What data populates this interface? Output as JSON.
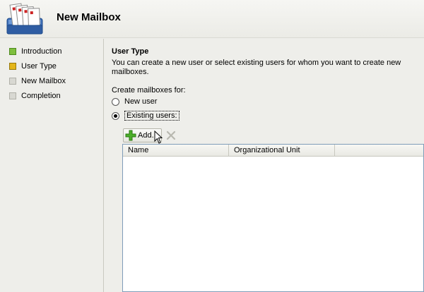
{
  "header": {
    "title": "New Mailbox"
  },
  "nav": {
    "items": [
      {
        "label": "Introduction",
        "state": "done"
      },
      {
        "label": "User Type",
        "state": "current"
      },
      {
        "label": "New Mailbox",
        "state": "pending"
      },
      {
        "label": "Completion",
        "state": "pending"
      }
    ]
  },
  "main": {
    "section_title": "User Type",
    "description": "You can create a new user or select existing users for whom you want to create new mailboxes.",
    "create_label": "Create mailboxes for:",
    "radios": [
      {
        "label": "New user",
        "checked": false
      },
      {
        "label": "Existing users:",
        "checked": true
      }
    ],
    "toolbar": {
      "add_label": "Add..."
    },
    "table": {
      "columns": [
        "Name",
        "Organizational Unit"
      ],
      "rows": []
    }
  },
  "colors": {
    "done": "#7fbf3e",
    "current": "#e4b61a",
    "pending": "#d8d8d2",
    "table_border": "#7f9db9"
  }
}
